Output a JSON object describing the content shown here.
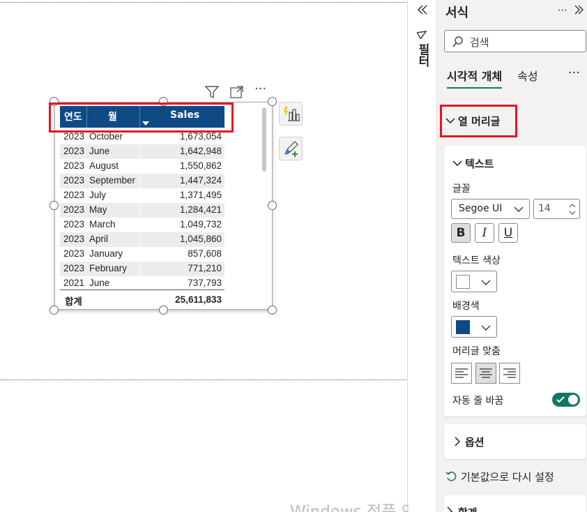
{
  "pane": {
    "title": "서식",
    "search_placeholder": "검색",
    "tabs": [
      "시각적 개체",
      "속성"
    ],
    "more": "···",
    "section_header": "열 머리글",
    "text_group": "텍스트",
    "font_label": "글꼴",
    "font_family": "Segoe UI",
    "font_size": "14",
    "bold": "B",
    "italic": "I",
    "underline": "U",
    "text_color_label": "텍스트 색상",
    "bg_color_label": "배경색",
    "align_label": "머리글 맞춤",
    "wrap_label": "자동 줄 바꿈",
    "options_label": "옵션",
    "reset_label": "기본값으로 다시 설정",
    "next_section_label": "합계",
    "colors": {
      "text": "#ffffff",
      "background": "#0e4a84",
      "toggle": "#117865"
    }
  },
  "filters_label": "필터",
  "table": {
    "headers": [
      "연도",
      "월",
      "Sales"
    ],
    "rows": [
      [
        "2023",
        "October",
        "1,673,054"
      ],
      [
        "2023",
        "June",
        "1,642,948"
      ],
      [
        "2023",
        "August",
        "1,550,862"
      ],
      [
        "2023",
        "September",
        "1,447,324"
      ],
      [
        "2023",
        "July",
        "1,371,495"
      ],
      [
        "2023",
        "May",
        "1,284,421"
      ],
      [
        "2023",
        "March",
        "1,049,732"
      ],
      [
        "2023",
        "April",
        "1,045,860"
      ],
      [
        "2023",
        "January",
        "857,608"
      ],
      [
        "2023",
        "February",
        "771,210"
      ],
      [
        "2021",
        "June",
        "737,793"
      ]
    ],
    "total_label": "합계",
    "total_value": "25,611,833"
  },
  "watermark": "Windows 정품 인증"
}
